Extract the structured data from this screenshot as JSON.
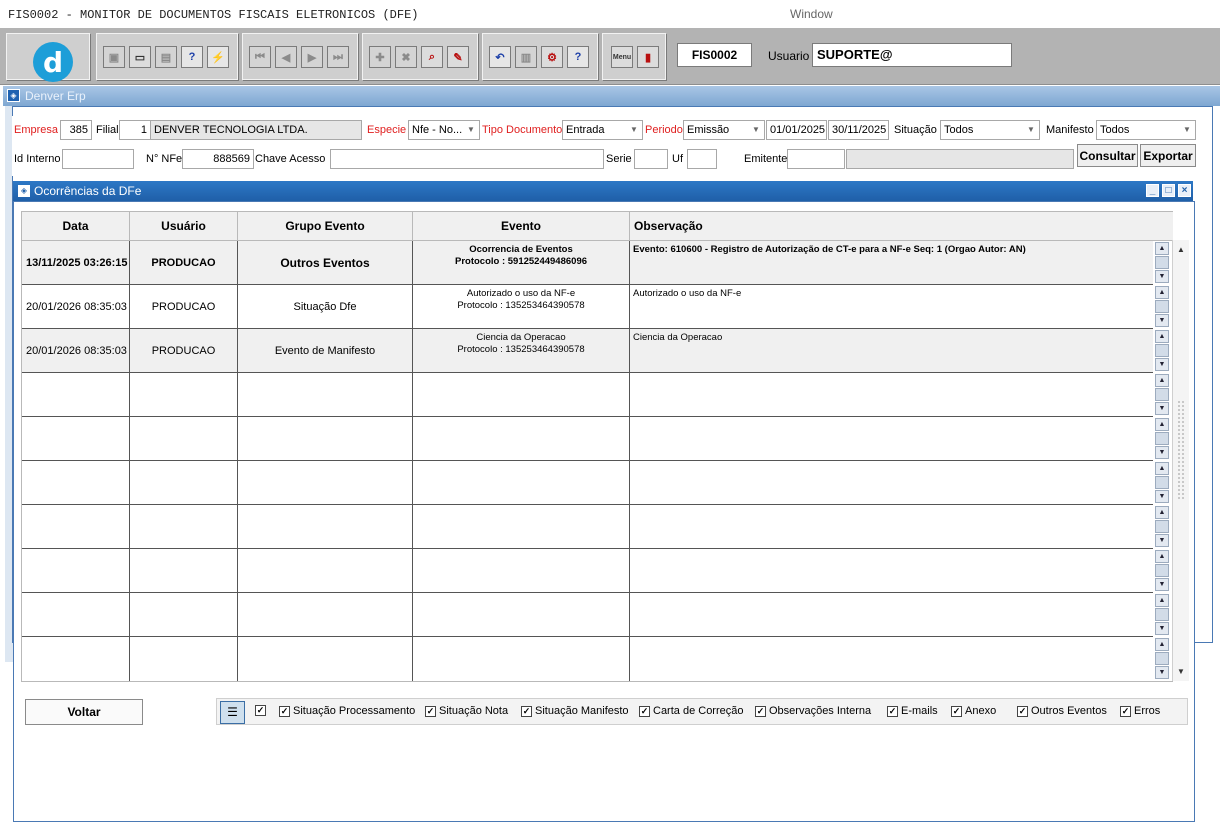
{
  "window": {
    "title": "FIS0002 - MONITOR DE DOCUMENTOS FISCAIS ELETRONICOS (DFE)",
    "menu_window": "Window"
  },
  "toolbar": {
    "logo_letter": "d",
    "program_code": "FIS0002",
    "user_label": "Usuario",
    "user_value": "SUPORTE@",
    "icons": [
      "save-icon",
      "screen-icon",
      "print-icon",
      "help-query-icon",
      "clear-query-icon",
      "first-icon",
      "prev-icon",
      "next-icon",
      "last-icon",
      "add-icon",
      "delete-icon",
      "find-icon",
      "erase-icon",
      "undo-icon",
      "paste-icon",
      "tools-icon",
      "help-icon",
      "menu-icon",
      "exit-icon"
    ],
    "menu_label": "Menu"
  },
  "frame": {
    "title": "Denver Erp"
  },
  "filters": {
    "empresa_label": "Empresa",
    "empresa_value": "385",
    "filial_label": "Filial",
    "filial_value": "1",
    "company_name": "DENVER TECNOLOGIA LTDA.",
    "especie_label": "Especie",
    "especie_value": "Nfe - No...",
    "tipo_label": "Tipo Documento",
    "tipo_value": "Entrada",
    "periodo_label": "Periodo",
    "periodo_value": "Emissão",
    "date_from": "01/01/2025",
    "date_to": "30/11/2025",
    "situacao_label": "Situação",
    "situacao_value": "Todos",
    "manifesto_label": "Manifesto",
    "manifesto_value": "Todos",
    "id_interno_label": "Id Interno",
    "id_interno_value": "",
    "nnfe_label": "N° NFe",
    "nnfe_value": "888569",
    "chave_label": "Chave Acesso",
    "chave_value": "",
    "serie_label": "Serie",
    "serie_value": "",
    "uf_label": "Uf",
    "uf_value": "",
    "emitente_label": "Emitente",
    "emitente_value": "",
    "consultar_label": "Consultar",
    "exportar_label": "Exportar"
  },
  "dialog": {
    "title": "Ocorrências da DFe",
    "columns": [
      "Data",
      "Usuário",
      "Grupo Evento",
      "Evento",
      "Observação"
    ],
    "rows": [
      {
        "data": "13/11/2025 03:26:15",
        "usuario": "PRODUCAO",
        "grupo": "Outros Eventos",
        "evento_line1": "Ocorrencia de Eventos",
        "evento_line2": "Protocolo : 591252449486096",
        "observacao": "Evento: 610600 - Registro de Autorização de CT-e para a NF-e  Seq: 1  (Orgao Autor: AN)",
        "bold": true
      },
      {
        "data": "20/01/2026 08:35:03",
        "usuario": "PRODUCAO",
        "grupo": "Situação Dfe",
        "evento_line1": "Autorizado o uso da NF-e",
        "evento_line2": "Protocolo : 135253464390578",
        "observacao": "Autorizado o uso da NF-e",
        "bold": false
      },
      {
        "data": "20/01/2026 08:35:03",
        "usuario": "PRODUCAO",
        "grupo": "Evento de Manifesto",
        "evento_line1": "Ciencia da Operacao",
        "evento_line2": "Protocolo : 135253464390578",
        "observacao": "Ciencia da Operacao",
        "bold": false
      }
    ],
    "voltar_label": "Voltar",
    "checkboxes": [
      {
        "label": "",
        "checked": true
      },
      {
        "label": "Situação Processamento",
        "checked": true
      },
      {
        "label": "Situação Nota",
        "checked": true
      },
      {
        "label": "Situação Manifesto",
        "checked": true
      },
      {
        "label": "Carta de Correção",
        "checked": true
      },
      {
        "label": "Observações Interna",
        "checked": true
      },
      {
        "label": "E-mails",
        "checked": true
      },
      {
        "label": "Anexo",
        "checked": true
      },
      {
        "label": "Outros Eventos",
        "checked": true
      },
      {
        "label": "Erros",
        "checked": true
      }
    ]
  }
}
